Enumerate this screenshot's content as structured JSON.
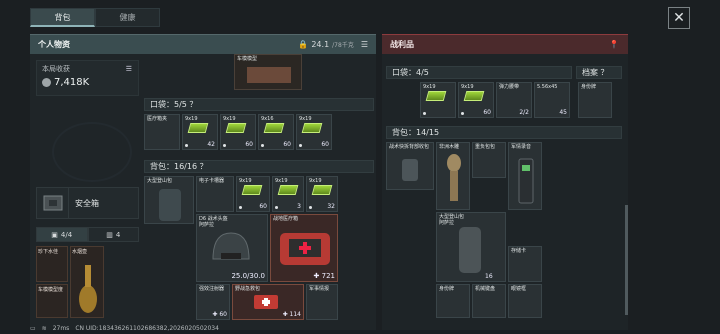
{
  "tabs": [
    {
      "label": "背包"
    },
    {
      "label": "健康"
    }
  ],
  "left": {
    "title": "个人物资",
    "capacity": "24.1",
    "capacity_max": "/78千克",
    "earnings_label": "本局收获",
    "earnings_value": "7,418K",
    "safe_label": "安全箱",
    "subtab1": "4/4",
    "subtab2": "4",
    "mini": [
      {
        "name": "珍下水佳"
      },
      {
        "name": "水烟壶"
      },
      {
        "name": "车模模型度"
      }
    ],
    "top_item": {
      "name": "车模模型"
    },
    "pocket": {
      "header": "口袋：5/5 ？",
      "items": [
        {
          "name": "医疗箱夹",
          "count": ""
        },
        {
          "name": "9x19",
          "count": "42"
        },
        {
          "name": "9x19",
          "count": "60"
        },
        {
          "name": "9x16",
          "count": "60"
        },
        {
          "name": "9x19",
          "count": "60"
        }
      ]
    },
    "backpack": {
      "header": "背包：16/16 ？",
      "bag_name": "大型登山包",
      "row1": [
        {
          "name": "电子卡槽器",
          "count": ""
        },
        {
          "name": "9x19",
          "count": "60"
        },
        {
          "name": "9x19",
          "count": "3"
        },
        {
          "name": "9x19",
          "count": "32"
        }
      ],
      "helmet": {
        "name": "D6 战术头盔",
        "sub": "阿萨拉",
        "dur": "25.0/30.0"
      },
      "medkit": {
        "name": "战地医疗箱",
        "count": "721"
      },
      "row3": [
        {
          "name": "强效注射器",
          "count": "60"
        },
        {
          "name": "野战急救包",
          "count": "114"
        },
        {
          "name": "军事情报",
          "count": ""
        }
      ]
    }
  },
  "right": {
    "title": "战利品",
    "pocket_header": "口袋：4/5",
    "archive_label": "档案 ？",
    "pocket_items": [
      {
        "name": "9x19",
        "count": ""
      },
      {
        "name": "9x19",
        "count": "60"
      },
      {
        "name": "弹力腰带",
        "count": "2/2"
      },
      {
        "name": "5.56x45",
        "count": "45"
      }
    ],
    "archive_item": {
      "name": "身份牌"
    },
    "backpack_header": "背包：14/15",
    "items": [
      {
        "name": "战术快拆背部收包",
        "count": ""
      },
      {
        "name": "非洲木雕",
        "count": ""
      },
      {
        "name": "重负包包",
        "count": ""
      },
      {
        "name": "军情录音",
        "count": ""
      },
      {
        "name": "大型登山包",
        "sub": "阿萨拉",
        "count": "16"
      },
      {
        "name": "存储卡",
        "count": ""
      },
      {
        "name": "身份牌",
        "count": ""
      },
      {
        "name": "机械键盘",
        "count": ""
      },
      {
        "name": "眼镜框",
        "count": ""
      }
    ]
  },
  "status": {
    "ping": "27ms",
    "uid": "CN UID:183436261102686382,2026020502034"
  }
}
